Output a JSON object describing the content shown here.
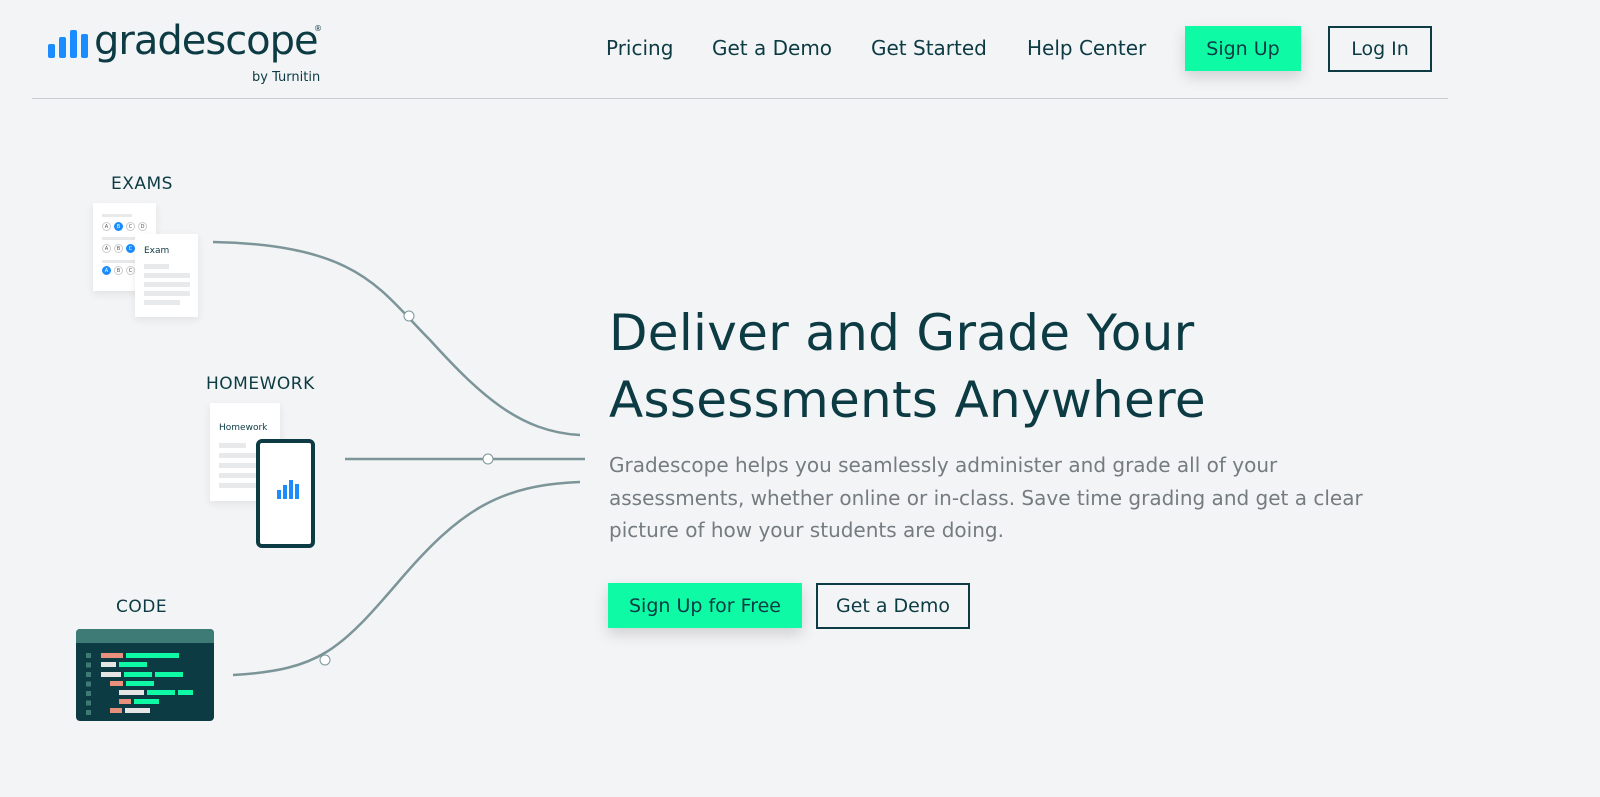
{
  "header": {
    "logo_text": "gradescope",
    "logo_sub": "by Turnitin",
    "nav": [
      "Pricing",
      "Get a Demo",
      "Get Started",
      "Help Center"
    ],
    "sign_up": "Sign Up",
    "log_in": "Log In"
  },
  "hero": {
    "title_line1": "Deliver and Grade Your",
    "title_line2": "Assessments Anywhere",
    "description": "Gradescope helps you seamlessly administer and grade all of your assessments, whether online or in-class. Save time grading and get a clear picture of how your students are doing.",
    "cta_primary": "Sign Up for Free",
    "cta_secondary": "Get a Demo"
  },
  "illustration": {
    "exams_label": "EXAMS",
    "exam_doc_title": "Exam",
    "homework_label": "HOMEWORK",
    "homework_doc_title": "Homework",
    "code_label": "CODE",
    "choices": [
      "A",
      "B",
      "C",
      "D"
    ]
  },
  "colors": {
    "primary": "#0c3b43",
    "accent": "#0ffaa5",
    "blue": "#1a8cff",
    "background": "#f3f4f6"
  }
}
